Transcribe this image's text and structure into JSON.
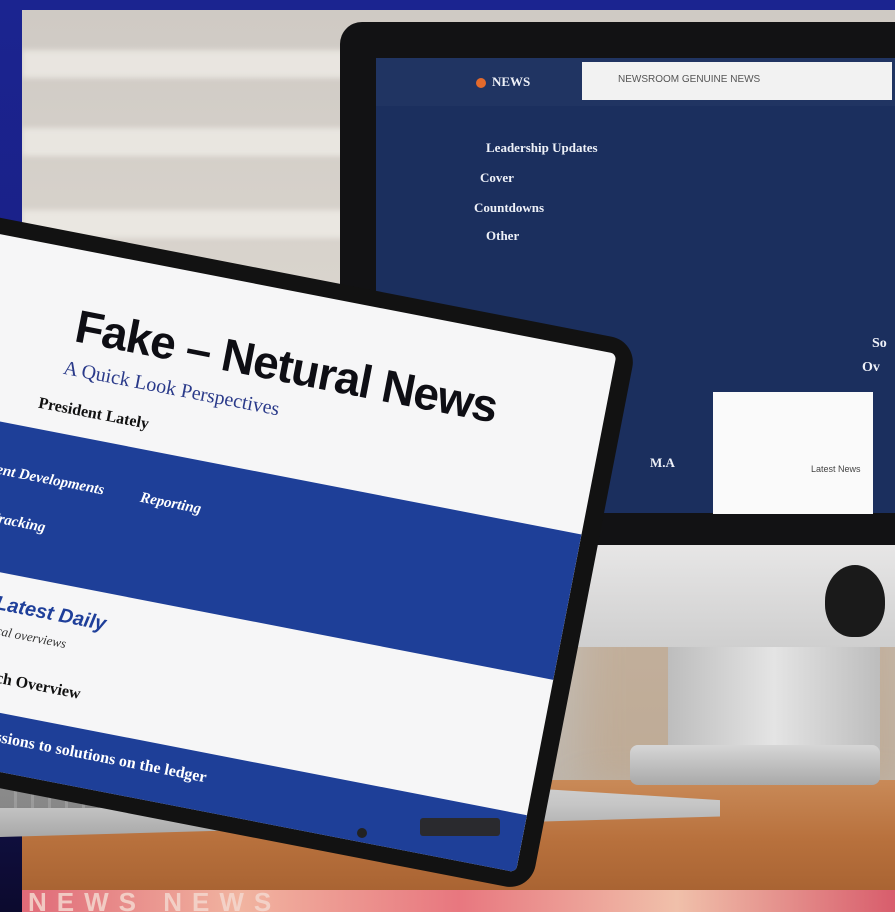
{
  "imac_screen": {
    "tab_label": "NEWS",
    "url_text": "NEWSROOM  GENUINE  NEWS",
    "menu": [
      "Leadership Updates",
      "Cover",
      "Countdowns",
      "Other"
    ],
    "right_lines": [
      "So",
      "Ov"
    ],
    "mid_label": "M.A",
    "box_text": "Latest News"
  },
  "laptop_screen": {
    "headline": "Fake – Netural News",
    "subhead": "A Quick Look Perspectives",
    "byline": "President Lately",
    "band_items": [
      "Recent Developments",
      "Reporting",
      "Stories Tracking"
    ],
    "blue_title": "Latest Daily",
    "small_text": "Local overviews",
    "mid_text": "Research Overview",
    "footer_text": "From discussions to solutions on the ledger"
  },
  "bottom_banner": "NEWS NEWS"
}
